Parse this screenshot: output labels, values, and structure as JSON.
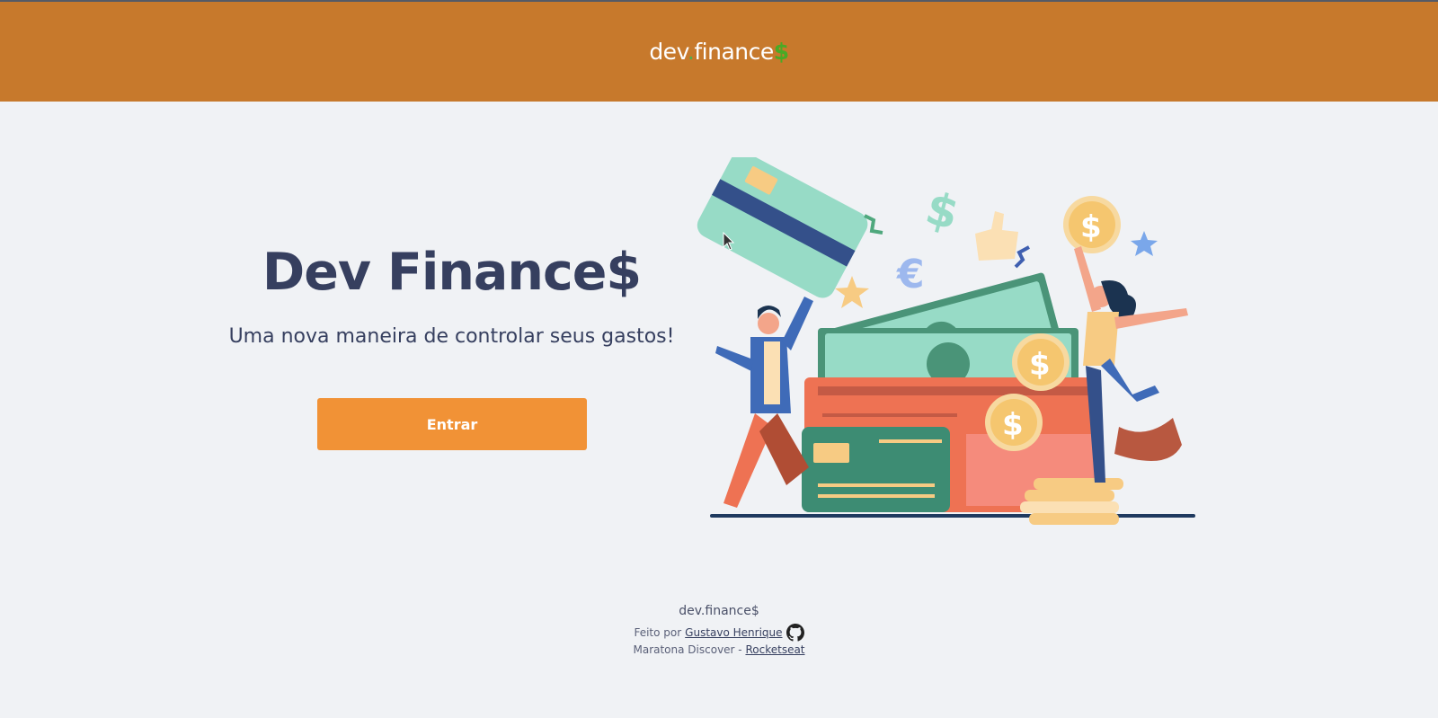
{
  "header": {
    "logo_part1": "dev",
    "logo_dot": ".",
    "logo_part2": "finance",
    "logo_dollar": "$"
  },
  "hero": {
    "title": "Dev Finance$",
    "subtitle": "Uma nova maneira de controlar seus gastos!",
    "button_label": "Entrar"
  },
  "footer": {
    "brand": "dev.finance$",
    "made_by_prefix": "Feito por",
    "author_link": "Gustavo Henrique",
    "event_prefix": "Maratona Discover -",
    "event_link": "Rocketseat"
  },
  "colors": {
    "header_bg": "#c7792c",
    "page_bg": "#f0f2f5",
    "accent": "#f19236",
    "text": "#363f5f",
    "green": "#49aa26"
  },
  "icons": {
    "github": "github-icon",
    "illustration": "wallet-money-illustration"
  }
}
